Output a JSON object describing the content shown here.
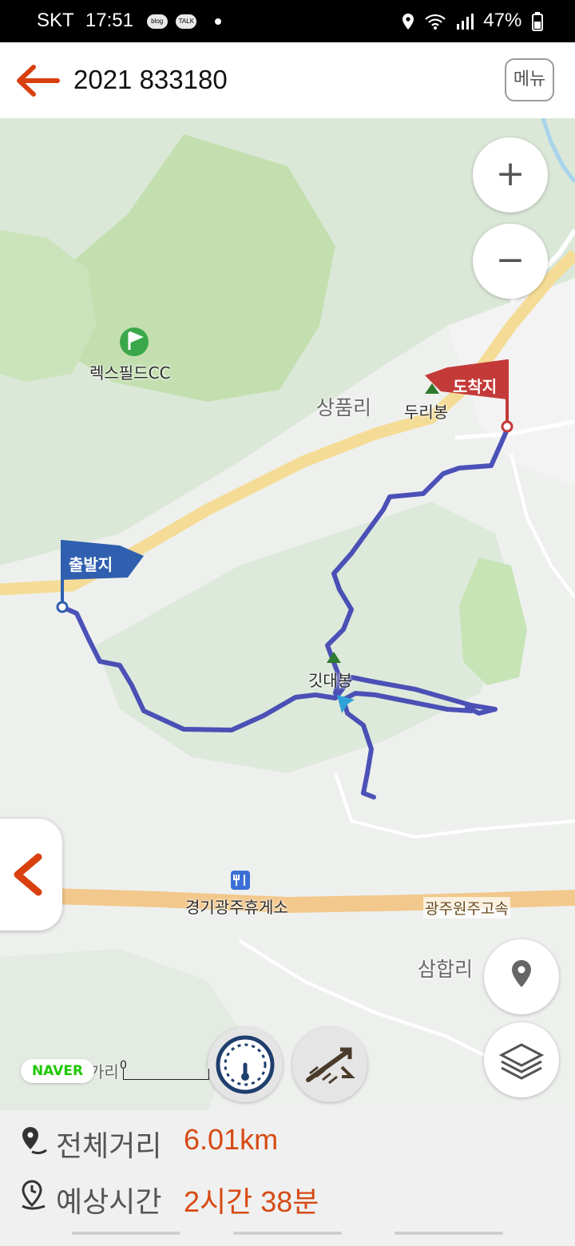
{
  "status_bar": {
    "carrier": "SKT",
    "time": "17:51",
    "notif_blog": "blog",
    "notif_talk": "TALK",
    "battery": "47%"
  },
  "header": {
    "title": "2021 833180",
    "menu_label": "메뉴"
  },
  "map": {
    "places": {
      "golf": "렉스필드CC",
      "village1": "상품리",
      "peak1": "두리봉",
      "peak2": "깃대봉",
      "rest_area": "경기광주휴게소",
      "highway": "광주원주고속",
      "village2": "삼합리",
      "partial_village": "가리"
    },
    "flags": {
      "start": "출발지",
      "end": "도착지"
    },
    "scale_label": "0",
    "attribution": "NAVER",
    "colors": {
      "route": "#3a3fb0",
      "start_flag": "#2f5fae",
      "end_flag": "#c43a38",
      "road": "#f5dc96",
      "highway": "#f2c88c",
      "forest": "#c8e6b4"
    }
  },
  "summary": {
    "distance_label": "전체거리",
    "distance_value": "6.01km",
    "time_label": "예상시간",
    "time_value": "2시간 38분"
  },
  "icons": {
    "back": "back-arrow-icon",
    "zoom_in": "plus-icon",
    "zoom_out": "minus-icon",
    "panel": "chevron-left-icon",
    "location": "location-pin-icon",
    "layers": "layers-icon",
    "speed": "speedometer-icon",
    "elevation": "elevation-icon"
  }
}
